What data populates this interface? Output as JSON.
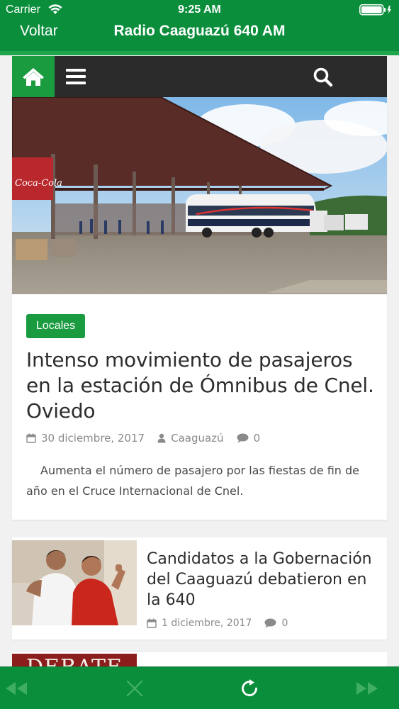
{
  "status_bar": {
    "carrier": "Carrier",
    "time": "9:25 AM"
  },
  "nav_bar": {
    "back_label": "Voltar",
    "title": "Radio Caaguazú 640 AM"
  },
  "site_menu": {
    "home_icon": "home-icon",
    "menu_icon": "hamburger-menu-icon",
    "search_icon": "search-icon"
  },
  "featured": {
    "category": "Locales",
    "title": "Intenso movimiento de pasajeros en la estación de Ómnibus de Cnel. Oviedo",
    "date": "30 diciembre, 2017",
    "author": "Caaguazú",
    "comments": "0",
    "excerpt": "Aumenta el número de pasajero por las fiestas de fin de año en el Cruce Internacional de Cnel."
  },
  "posts": [
    {
      "title": "Candidatos a la Gobernación del Caaguazú debatieron en la 640",
      "date": "1 diciembre, 2017",
      "comments": "0"
    }
  ],
  "peek_post": {
    "image_text": "DEBATE"
  },
  "toolbar": {
    "icons": [
      "rewind-icon",
      "stop-icon",
      "reload-icon",
      "fast-forward-icon"
    ]
  },
  "colors": {
    "brand_green": "#0a8e3c",
    "accent_green": "#1b9b40",
    "menu_dark": "#2b2b2b"
  }
}
